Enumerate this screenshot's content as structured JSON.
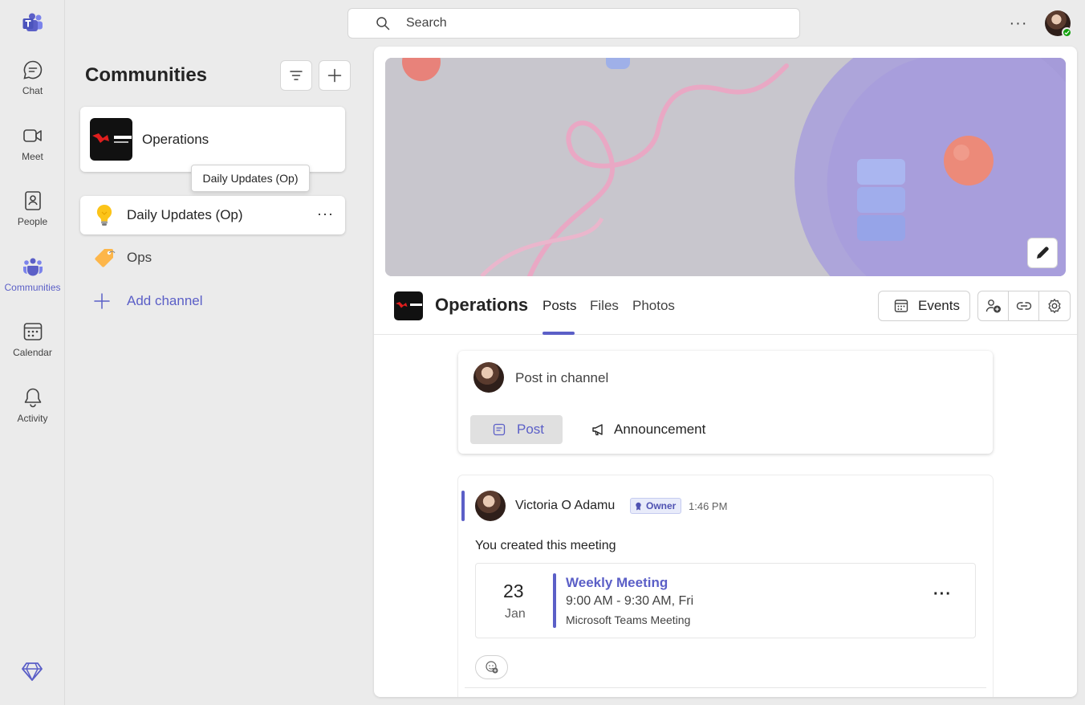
{
  "rail": {
    "items": [
      {
        "label": "Chat",
        "icon": "chat-icon"
      },
      {
        "label": "Meet",
        "icon": "video-icon"
      },
      {
        "label": "People",
        "icon": "contacts-icon"
      },
      {
        "label": "Communities",
        "icon": "communities-icon"
      },
      {
        "label": "Calendar",
        "icon": "calendar-icon"
      },
      {
        "label": "Activity",
        "icon": "bell-icon"
      }
    ],
    "active": "Communities"
  },
  "top": {
    "search_placeholder": "Search"
  },
  "panel": {
    "title": "Communities",
    "community": {
      "name": "Operations"
    },
    "tooltip": "Daily Updates (Op)",
    "channels": [
      {
        "name": "Daily Updates (Op)",
        "icon": "lightbulb-icon",
        "selected": true
      },
      {
        "name": "Ops",
        "icon": "tag-icon",
        "selected": false
      }
    ],
    "add_channel": "Add channel"
  },
  "main": {
    "title": "Operations",
    "tabs": [
      "Posts",
      "Files",
      "Photos"
    ],
    "active_tab": "Posts",
    "events_label": "Events",
    "compose": {
      "placeholder": "Post in channel",
      "post_label": "Post",
      "announcement_label": "Announcement"
    },
    "message": {
      "author": "Victoria O Adamu",
      "role_badge": "Owner",
      "time": "1:46 PM",
      "text": "You created this meeting",
      "meeting": {
        "day": "23",
        "month": "Jan",
        "title": "Weekly Meeting",
        "time": "9:00 AM - 9:30 AM, Fri",
        "type": "Microsoft Teams Meeting"
      }
    }
  },
  "colors": {
    "accent": "#5b5fc7",
    "presence": "#13a10e",
    "background": "#ebebeb"
  }
}
